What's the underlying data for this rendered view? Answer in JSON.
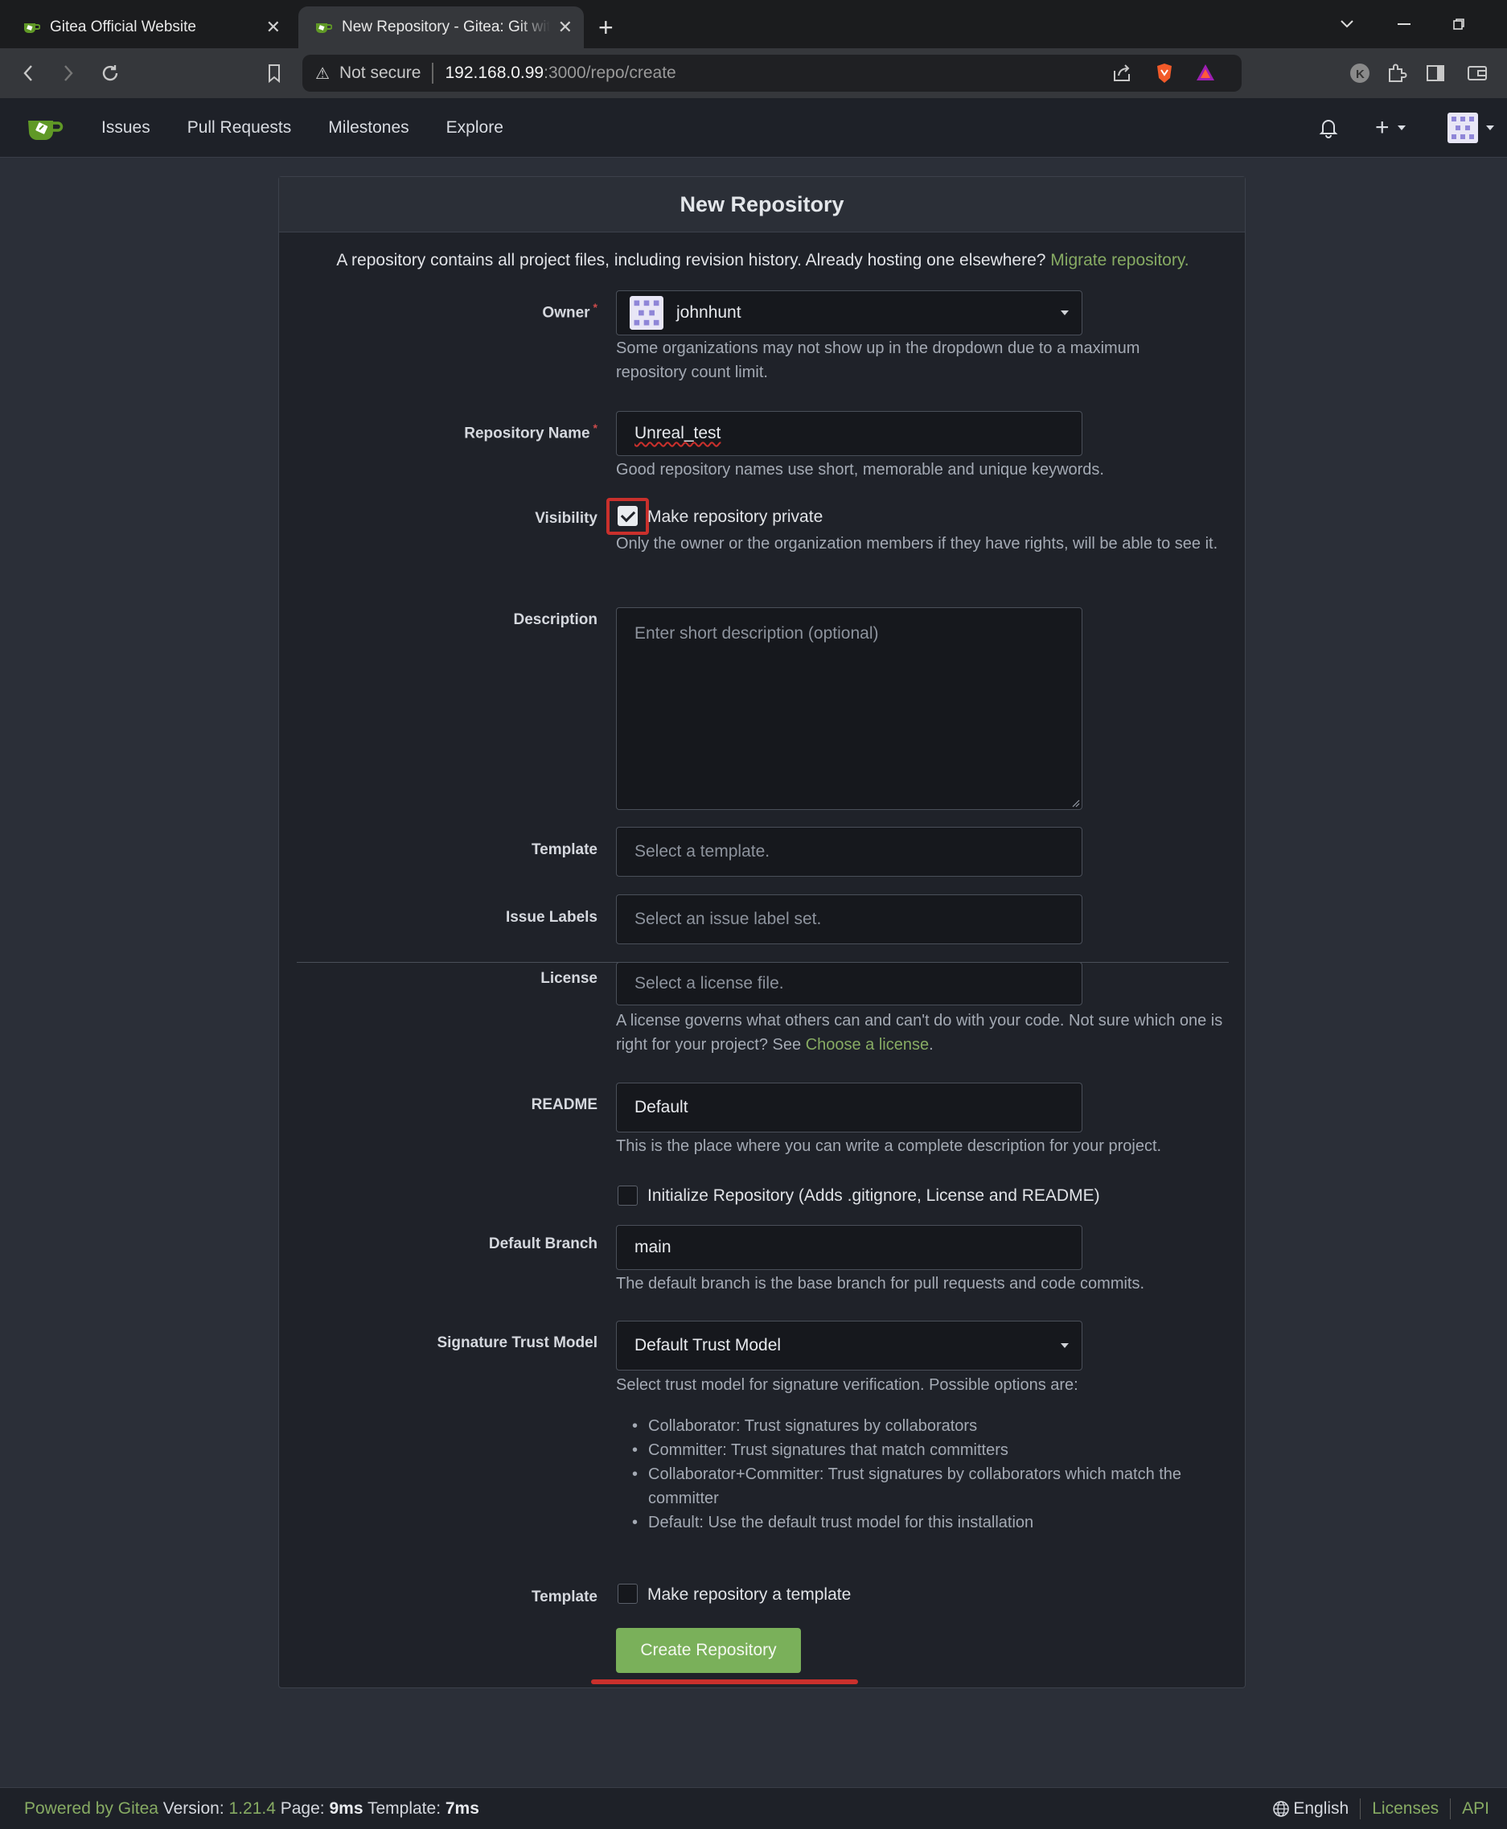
{
  "browser": {
    "tabs": [
      {
        "title": "Gitea Official Website",
        "active": false
      },
      {
        "title": "New Repository - Gitea: Git with a cup of tea",
        "active": true
      }
    ],
    "new_tab": "+",
    "address": {
      "security_label": "Not secure",
      "host": "192.168.0.99",
      "path": ":3000/repo/create"
    }
  },
  "header": {
    "nav": [
      "Issues",
      "Pull Requests",
      "Milestones",
      "Explore"
    ],
    "plus": "+"
  },
  "form": {
    "title": "New Repository",
    "intro_text": "A repository contains all project files, including revision history. Already hosting one elsewhere? ",
    "intro_link": "Migrate repository.",
    "owner": {
      "label": "Owner",
      "value": "johnhunt",
      "help": "Some organizations may not show up in the dropdown due to a maximum repository count limit."
    },
    "repo_name": {
      "label": "Repository Name",
      "value": "Unreal_test",
      "help": "Good repository names use short, memorable and unique keywords."
    },
    "visibility": {
      "label": "Visibility",
      "checkbox_label": "Make repository private",
      "checked": true,
      "help": "Only the owner or the organization members if they have rights, will be able to see it."
    },
    "description": {
      "label": "Description",
      "placeholder": "Enter short description (optional)"
    },
    "template": {
      "label": "Template",
      "placeholder": "Select a template."
    },
    "issue_labels": {
      "label": "Issue Labels",
      "placeholder": "Select an issue label set."
    },
    "license": {
      "label": "License",
      "placeholder": "Select a license file.",
      "help": "A license governs what others can and can't do with your code. Not sure which one is right for your project? See ",
      "help_link": "Choose a license",
      "help_end": "."
    },
    "readme": {
      "label": "README",
      "value": "Default",
      "help": "This is the place where you can write a complete description for your project."
    },
    "init_repo": {
      "checkbox_label": "Initialize Repository (Adds .gitignore, License and README)",
      "checked": false
    },
    "default_branch": {
      "label": "Default Branch",
      "value": "main",
      "help": "The default branch is the base branch for pull requests and code commits."
    },
    "trust_model": {
      "label": "Signature Trust Model",
      "value": "Default Trust Model",
      "help": "Select trust model for signature verification. Possible options are:",
      "options": [
        "Collaborator: Trust signatures by collaborators",
        "Committer: Trust signatures that match committers",
        "Collaborator+Committer: Trust signatures by collaborators which match the committer",
        "Default: Use the default trust model for this installation"
      ]
    },
    "make_template": {
      "label": "Template",
      "checkbox_label": "Make repository a template",
      "checked": false
    },
    "submit": "Create Repository"
  },
  "footer": {
    "powered_by": "Powered by Gitea",
    "version_label": "Version:",
    "version": "1.21.4",
    "page_label": "Page:",
    "page_time": "9ms",
    "template_label": "Template:",
    "template_time": "7ms",
    "language": "English",
    "licenses": "Licenses",
    "api": "API"
  },
  "colors": {
    "accent_green": "#7ab05a",
    "link_green": "#87ab63",
    "annotation_red": "#c9302c"
  }
}
